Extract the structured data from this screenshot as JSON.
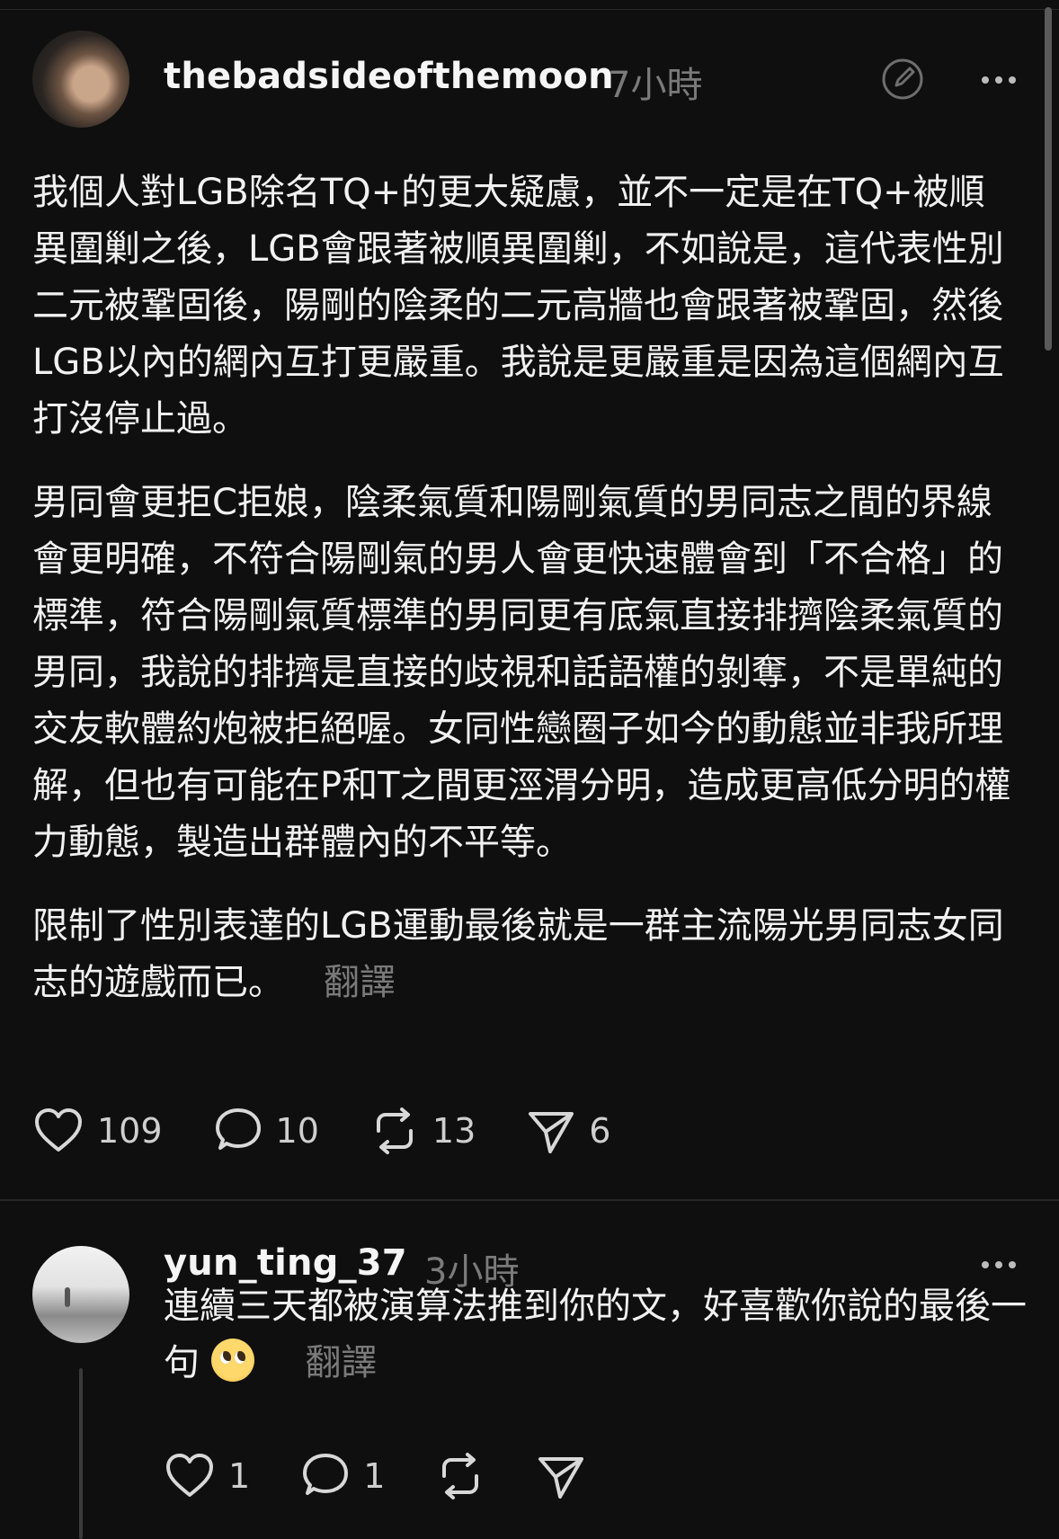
{
  "post": {
    "username": "thebadsideofthemoon",
    "time": "7小時",
    "paragraphs": [
      "我個人對LGB除名TQ+的更大疑慮，並不一定是在TQ+被順異圍剿之後，LGB會跟著被順異圍剿，不如說是，這代表性別二元被鞏固後，陽剛的陰柔的二元高牆也會跟著被鞏固，然後LGB以內的網內互打更嚴重。我說是更嚴重是因為這個網內互打沒停止過。",
      "男同會更拒C拒娘，陰柔氣質和陽剛氣質的男同志之間的界線會更明確，不符合陽剛氣的男人會更快速體會到「不合格」的標準，符合陽剛氣質標準的男同更有底氣直接排擠陰柔氣質的男同，我說的排擠是直接的歧視和話語權的剝奪，不是單純的交友軟體約炮被拒絕喔。女同性戀圈子如今的動態並非我所理解，但也有可能在P和T之間更涇渭分明，造成更高低分明的權力動態，製造出群體內的不平等。",
      "限制了性別表達的LGB運動最後就是一群主流陽光男同志女同志的遊戲而已。"
    ],
    "translate_label": "翻譯",
    "likes": "109",
    "comments": "10",
    "reposts": "13",
    "shares": "6"
  },
  "reply": {
    "username": "yun_ting_37",
    "time": "3小時",
    "text": "連續三天都被演算法推到你的文，好喜歡你說的最後一句",
    "translate_label": "翻譯",
    "likes": "1",
    "comments": "1"
  },
  "icons": {
    "edit": "edit-circle-icon",
    "more": "more-dots-icon",
    "like": "heart-icon",
    "comment": "comment-bubble-icon",
    "repost": "repost-icon",
    "share": "send-icon",
    "emoji": "pleading-face-emoji"
  },
  "colors": {
    "background": "#0f0f0f",
    "text": "#f1f1f1",
    "muted": "#7a7a7a"
  }
}
